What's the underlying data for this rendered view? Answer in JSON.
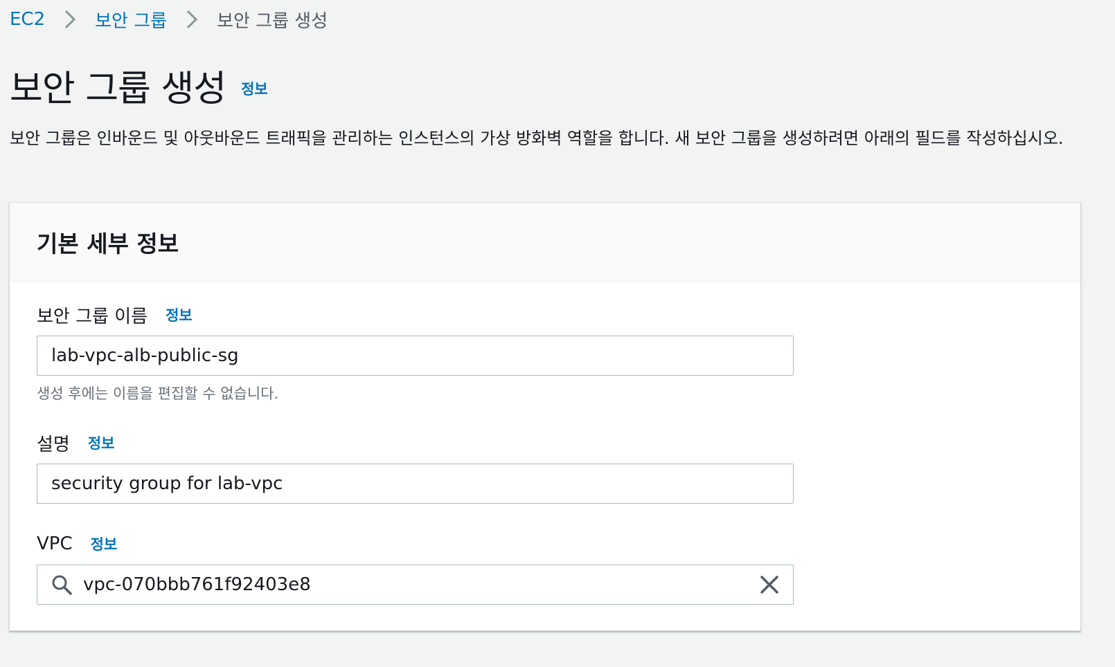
{
  "breadcrumb": {
    "items": [
      {
        "label": "EC2"
      },
      {
        "label": "보안 그룹"
      },
      {
        "label": "보안 그룹 생성"
      }
    ]
  },
  "page": {
    "title": "보안 그룹 생성",
    "info_label": "정보",
    "description": "보안 그룹은 인바운드 및 아웃바운드 트래픽을 관리하는 인스턴스의 가상 방화벽 역할을 합니다. 새 보안 그룹을 생성하려면 아래의 필드를 작성하십시오."
  },
  "basic_details": {
    "title": "기본 세부 정보",
    "name_field": {
      "label": "보안 그룹 이름",
      "info_label": "정보",
      "value": "lab-vpc-alb-public-sg",
      "hint": "생성 후에는 이름을 편집할 수 없습니다."
    },
    "description_field": {
      "label": "설명",
      "info_label": "정보",
      "value": "security group for lab-vpc"
    },
    "vpc_field": {
      "label": "VPC",
      "info_label": "정보",
      "value": "vpc-070bbb761f92403e8"
    }
  },
  "icons": {
    "breadcrumb_separator": "chevron-right-icon",
    "search": "search-icon",
    "clear": "close-icon"
  },
  "colors": {
    "link": "#0073bb",
    "page_background": "#f2f3f3",
    "text": "#16191f",
    "hint": "#687078"
  }
}
